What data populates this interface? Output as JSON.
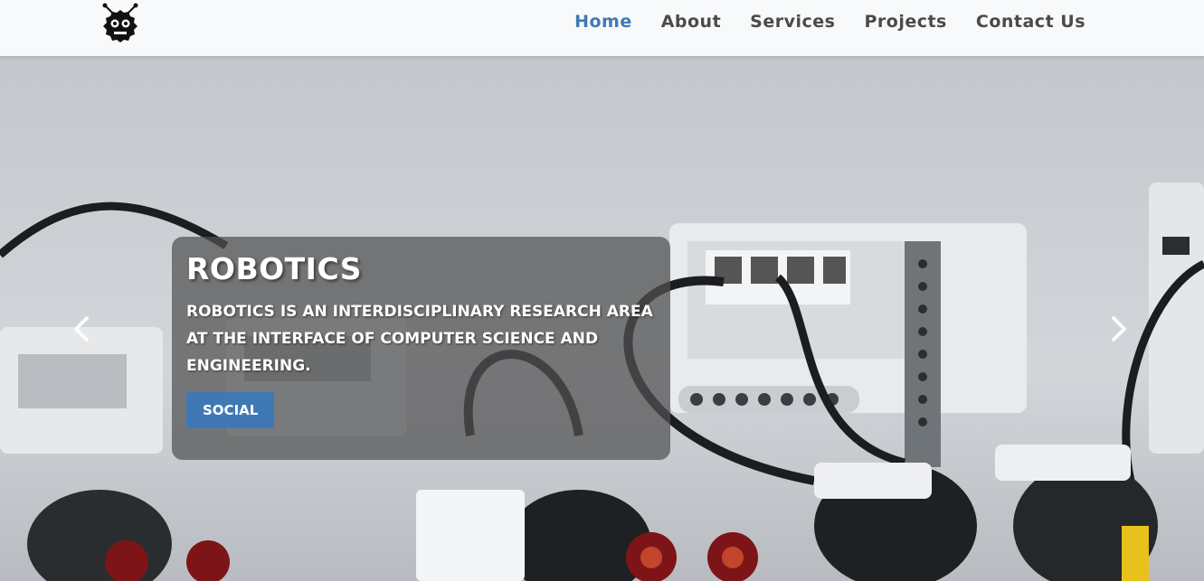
{
  "nav": {
    "items": [
      {
        "label": "Home",
        "active": true
      },
      {
        "label": "About",
        "active": false
      },
      {
        "label": "Services",
        "active": false
      },
      {
        "label": "Projects",
        "active": false
      },
      {
        "label": "Contact Us",
        "active": false
      }
    ],
    "logo_icon": "robot-gear-icon"
  },
  "hero": {
    "title": "ROBOTICS",
    "text": "ROBOTICS IS AN INTERDISCIPLINARY RESEARCH AREA AT THE INTERFACE OF COMPUTER SCIENCE AND ENGINEERING.",
    "button_label": "SOCIAL",
    "prev_icon": "chevron-left-icon",
    "next_icon": "chevron-right-icon",
    "background": "lego-robots-photo"
  },
  "colors": {
    "accent": "#3f79b5",
    "nav_text": "#4a4a4a",
    "navbar_bg": "#f8f9fa"
  }
}
